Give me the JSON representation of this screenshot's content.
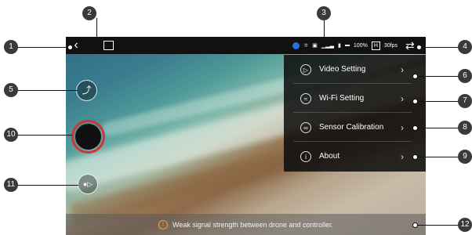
{
  "topbar": {
    "back_icon": "back-chevron-icon",
    "gallery_icon": "gallery-icon",
    "battery_pct": "100%",
    "resolution_tag": "H",
    "fps": "30fps",
    "settings_icon": "settings-sliders-icon"
  },
  "menu": {
    "items": [
      {
        "label": "Video Setting",
        "icon": "video-setting-icon"
      },
      {
        "label": "Wi-Fi Setting",
        "icon": "wifi-icon"
      },
      {
        "label": "Sensor Calibration",
        "icon": "sensor-calibration-icon"
      },
      {
        "label": "About",
        "icon": "info-icon"
      }
    ]
  },
  "warning": {
    "text": "Weak signal strength between drone and controller."
  },
  "callouts": [
    "1",
    "2",
    "3",
    "4",
    "5",
    "6",
    "7",
    "8",
    "9",
    "10",
    "11",
    "12"
  ],
  "colors": {
    "shutter_ring": "#d03535",
    "warning_icon": "#f5a623",
    "lock_badge": "#2a6fd6"
  }
}
